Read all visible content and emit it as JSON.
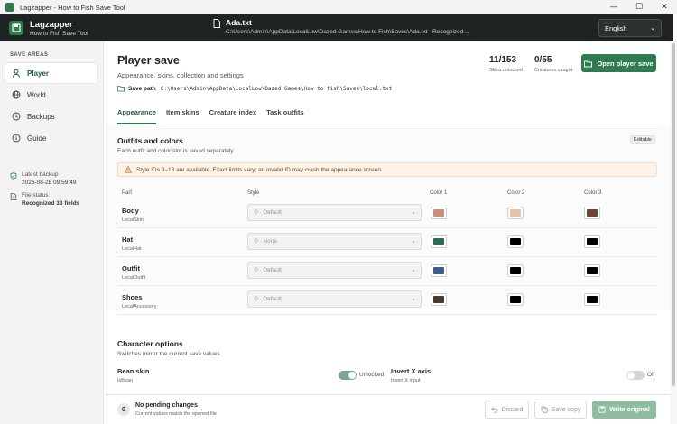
{
  "window": {
    "title": "Lagzapper - How to Fish Save Tool",
    "minimize_glyph": "—",
    "maximize_glyph": "☐",
    "close_glyph": "✕"
  },
  "header": {
    "brand_name": "Lagzapper",
    "brand_sub": "How to Fish Save Tool",
    "file_name": "Ada.txt",
    "file_path": "C:\\Users\\Admin\\AppData\\LocalLow\\Dazed Games\\How to Fish\\Saves\\Ada.txt - Recognized ...",
    "language": "English",
    "chevron": "⌄"
  },
  "sidebar": {
    "heading": "SAVE AREAS",
    "items": [
      {
        "label": "Player",
        "icon": "user-icon"
      },
      {
        "label": "World",
        "icon": "globe-icon"
      },
      {
        "label": "Backups",
        "icon": "history-icon"
      },
      {
        "label": "Guide",
        "icon": "info-icon"
      }
    ],
    "backup_label": "Latest backup",
    "backup_value": "2026-08-28 09:59:49",
    "status_label": "File status",
    "status_value": "Recognized 33 fields"
  },
  "main": {
    "title": "Player save",
    "subtitle": "Appearance, skins, collection and settings",
    "save_path_label": "Save path",
    "save_path_value": "C:\\Users\\Admin\\AppData\\LocalLow\\Dazed Games\\How to fish\\Saves\\local.txt",
    "stats": [
      {
        "value": "11/153",
        "label": "Skins unlocked"
      },
      {
        "value": "0/55",
        "label": "Creatures caught"
      }
    ],
    "open_button": "Open player save",
    "tabs": [
      "Appearance",
      "Item skins",
      "Creature index",
      "Task outfits"
    ]
  },
  "outfits": {
    "title": "Outfits and colors",
    "subtitle": "Each outfit and color slot is saved separately",
    "badge": "Editable",
    "warning": "Style IDs 0–13 are available. Exact limits vary; an invalid ID may crash the appearance screen.",
    "columns": [
      "Part",
      "Style",
      "Color 1",
      "Color 2",
      "Color 3"
    ],
    "rows": [
      {
        "name": "Body",
        "key": "LocalSkin",
        "style": "0 · Default",
        "colors": [
          "#c98f7a",
          "#e8c3a6",
          "#6b4636"
        ]
      },
      {
        "name": "Hat",
        "key": "LocalHat",
        "style": "0 · None",
        "colors": [
          "#2f6a56",
          "#000000",
          "#000000"
        ]
      },
      {
        "name": "Outfit",
        "key": "LocalOutfit",
        "style": "0 · Default",
        "colors": [
          "#3f5b8a",
          "#000000",
          "#000000"
        ]
      },
      {
        "name": "Shoes",
        "key": "LocalAccessory",
        "style": "0 · Default",
        "colors": [
          "#4a3a30",
          "#000000",
          "#000000"
        ]
      }
    ]
  },
  "character": {
    "title": "Character options",
    "subtitle": "Switches mirror the current save values",
    "options": [
      {
        "name": "Bean skin",
        "key": "IsBean",
        "state": "Unlocked",
        "on": true
      },
      {
        "name": "Invert X axis",
        "key": "Invert X input",
        "state": "Off",
        "on": false
      }
    ]
  },
  "footer": {
    "count": "0",
    "title": "No pending changes",
    "subtitle": "Current values match the opened file",
    "discard": "Discard",
    "save_copy": "Save copy",
    "write_original": "Write original"
  },
  "colors": {
    "accent": "#2f7a4f",
    "header_bg": "#1f2422",
    "sidebar_bg": "#f2f3f2"
  }
}
